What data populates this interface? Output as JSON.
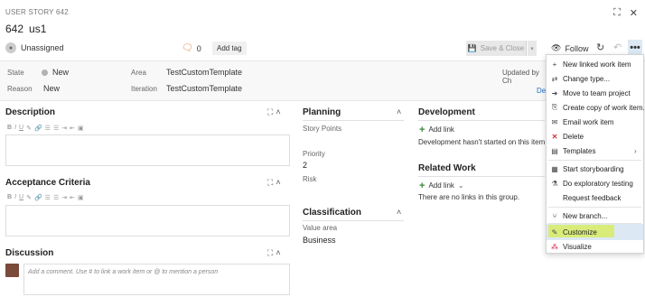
{
  "header": {
    "type_label": "USER STORY 642",
    "id": "642",
    "title": "us1",
    "assignee": "Unassigned",
    "comment_count": "0",
    "add_tag": "Add tag",
    "save_label": "Save & Close",
    "follow_label": "Follow"
  },
  "fields": {
    "state_label": "State",
    "state_value": "New",
    "reason_label": "Reason",
    "reason_value": "New",
    "area_label": "Area",
    "area_value": "TestCustomTemplate",
    "iteration_label": "Iteration",
    "iteration_value": "TestCustomTemplate",
    "updated_by": "Updated by Ch",
    "details_tab": "De"
  },
  "sections": {
    "description": "Description",
    "acceptance": "Acceptance Criteria",
    "discussion": "Discussion",
    "discussion_placeholder": "Add a comment. Use # to link a work item or @ to mention a person",
    "planning": "Planning",
    "story_points": "Story Points",
    "priority_label": "Priority",
    "priority_value": "2",
    "risk": "Risk",
    "classification": "Classification",
    "value_area_label": "Value area",
    "value_area_value": "Business",
    "development": "Development",
    "add_link": "Add link",
    "dev_note": "Development hasn't started on this item.",
    "related_work": "Related Work",
    "related_note": "There are no links in this group."
  },
  "menu": {
    "items": [
      {
        "label": "New linked work item",
        "icon": "plus-icon"
      },
      {
        "label": "Change type...",
        "icon": "swap-icon"
      },
      {
        "label": "Move to team project",
        "icon": "move-icon"
      },
      {
        "label": "Create copy of work item...",
        "icon": "copy-icon"
      },
      {
        "label": "Email work item",
        "icon": "email-icon"
      },
      {
        "label": "Delete",
        "icon": "delete-x-icon",
        "color": "#d13438"
      },
      {
        "label": "Templates",
        "icon": "template-icon"
      },
      {
        "label": "Start storyboarding",
        "icon": "storyboard-icon"
      },
      {
        "label": "Do exploratory testing",
        "icon": "flask-icon"
      },
      {
        "label": "Request feedback",
        "icon": ""
      },
      {
        "label": "New branch...",
        "icon": "branch-icon"
      },
      {
        "label": "Customize",
        "icon": "customize-icon"
      },
      {
        "label": "Visualize",
        "icon": "visualize-icon"
      }
    ]
  },
  "colors": {
    "highlight": "#d9ec7a",
    "menu_hover": "#dce9f5",
    "add_green": "#3a8a3a",
    "delete_red": "#d13438"
  }
}
